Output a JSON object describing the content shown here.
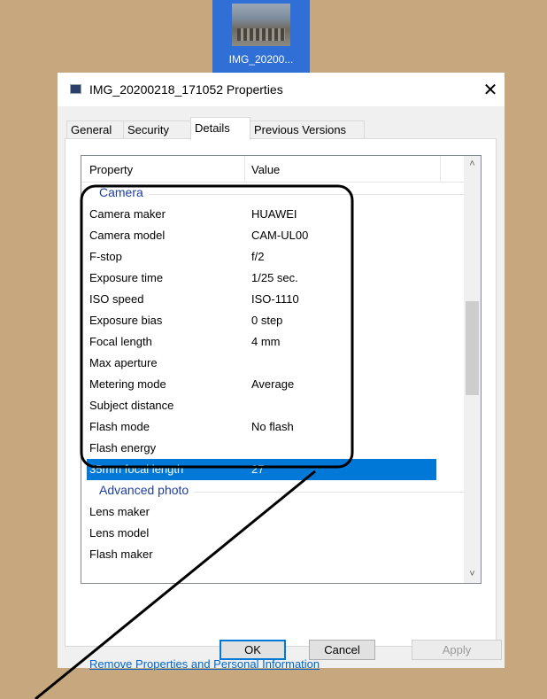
{
  "desktop_icon": {
    "label": "IMG_20200..."
  },
  "dialog": {
    "title": "IMG_20200218_171052 Properties",
    "close_glyph": "✕",
    "tabs": [
      {
        "label": "General",
        "active": false
      },
      {
        "label": "Security",
        "active": false
      },
      {
        "label": "Details",
        "active": true
      },
      {
        "label": "Previous Versions",
        "active": false
      }
    ],
    "columns": {
      "property": "Property",
      "value": "Value"
    },
    "groups": {
      "camera": "Camera",
      "advanced": "Advanced photo"
    },
    "camera_rows": [
      {
        "property": "Camera maker",
        "value": "HUAWEI"
      },
      {
        "property": "Camera model",
        "value": "CAM-UL00"
      },
      {
        "property": "F-stop",
        "value": "f/2"
      },
      {
        "property": "Exposure time",
        "value": "1/25 sec."
      },
      {
        "property": "ISO speed",
        "value": "ISO-1110"
      },
      {
        "property": "Exposure bias",
        "value": "0 step"
      },
      {
        "property": "Focal length",
        "value": "4 mm"
      },
      {
        "property": "Max aperture",
        "value": ""
      },
      {
        "property": "Metering mode",
        "value": "Average"
      },
      {
        "property": "Subject distance",
        "value": ""
      },
      {
        "property": "Flash mode",
        "value": "No flash"
      },
      {
        "property": "Flash energy",
        "value": ""
      },
      {
        "property": "35mm focal length",
        "value": "27",
        "selected": true
      }
    ],
    "advanced_rows": [
      {
        "property": "Lens maker",
        "value": ""
      },
      {
        "property": "Lens model",
        "value": ""
      },
      {
        "property": "Flash maker",
        "value": ""
      }
    ],
    "scroll_up_glyph": "˄",
    "scroll_down_glyph": "˅",
    "remove_link": "Remove Properties and Personal Information",
    "buttons": {
      "ok": "OK",
      "cancel": "Cancel",
      "apply": "Apply"
    }
  },
  "annotation": {
    "color": "#000000"
  }
}
